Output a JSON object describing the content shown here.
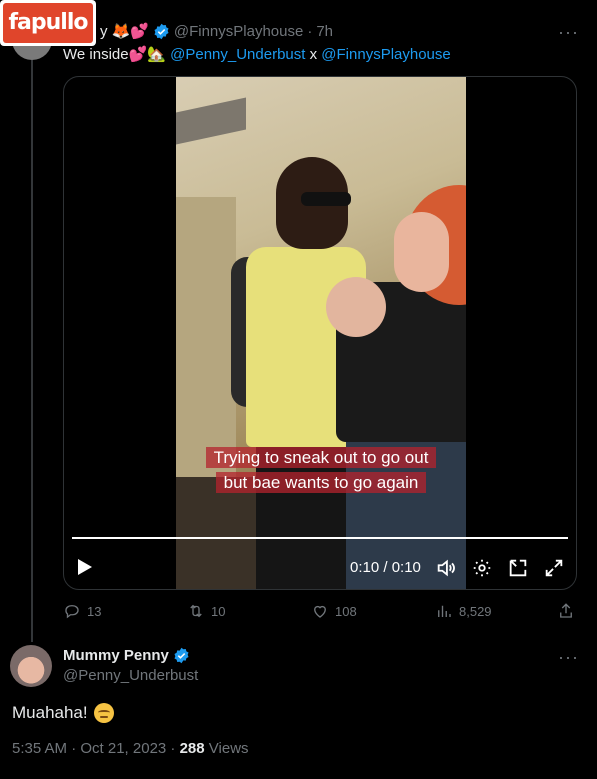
{
  "logo": {
    "text": "fapullo"
  },
  "tweet": {
    "name_partial": "y",
    "name_emojis": "🦊💕",
    "handle": "@FinnysPlayhouse",
    "time": "7h",
    "time_sep": "·",
    "text_prefix": "We inside💕🏡",
    "mention1": "@Penny_Underbust",
    "x": "x",
    "mention2": "@FinnysPlayhouse",
    "more": "···"
  },
  "video": {
    "caption_line1": "Trying to sneak out to go out",
    "caption_line2": "but bae wants to go again",
    "time": "0:10 / 0:10",
    "progress": 1.0
  },
  "actions": {
    "replies": "13",
    "reposts": "10",
    "likes": "108",
    "views": "8,529"
  },
  "reply": {
    "name": "Mummy Penny",
    "handle": "@Penny_Underbust",
    "text": "Muahaha!",
    "more": "···",
    "timestamp": "5:35 AM · Oct 21, 2023 · ",
    "views_count": "288",
    "views_label": " Views"
  },
  "colors": {
    "accent": "#1d9bf0",
    "muted": "#71767b",
    "background": "#000000"
  }
}
